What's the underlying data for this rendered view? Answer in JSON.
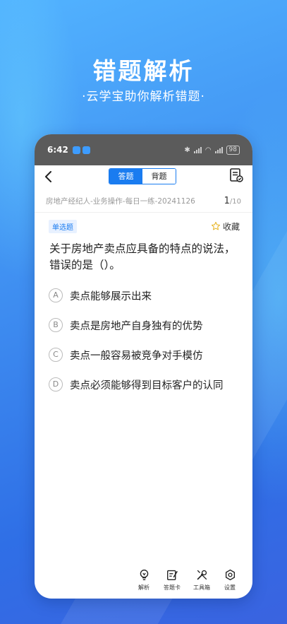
{
  "hero": {
    "title": "错题解析",
    "subtitle": "·云学宝助你解析错题·"
  },
  "status_bar": {
    "time": "6:42",
    "battery": "98"
  },
  "nav": {
    "tabs": [
      {
        "label": "答题",
        "active": true
      },
      {
        "label": "背题",
        "active": false
      }
    ]
  },
  "exam": {
    "name": "房地产经纪人-业务操作-每日一练-20241126",
    "current": "1",
    "total": "/10"
  },
  "question": {
    "type": "单选题",
    "favorite_label": "收藏",
    "text": "关于房地产卖点应具备的特点的说法，错误的是（）。",
    "options": [
      {
        "letter": "A",
        "text": "卖点能够展示出来"
      },
      {
        "letter": "B",
        "text": "卖点是房地产自身独有的优势"
      },
      {
        "letter": "C",
        "text": "卖点一般容易被竞争对手模仿"
      },
      {
        "letter": "D",
        "text": "卖点必须能够得到目标客户的认同"
      }
    ]
  },
  "toolbar": {
    "analysis": "解析",
    "answer_card": "答题卡",
    "toolbox": "工具箱",
    "settings": "设置"
  },
  "colors": {
    "accent": "#1a7cf0",
    "status_bar": "#5b5b5b"
  }
}
